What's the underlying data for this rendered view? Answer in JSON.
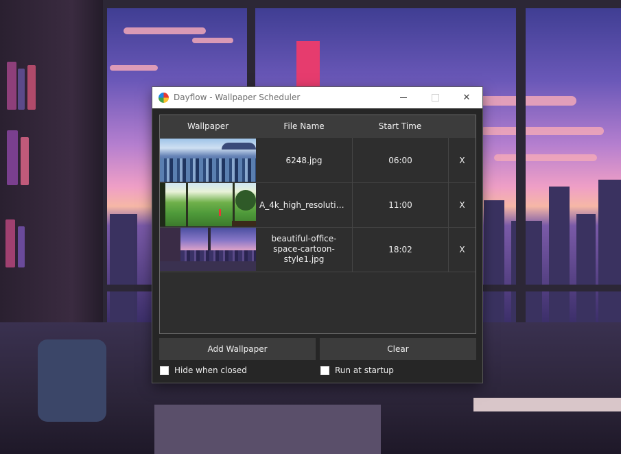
{
  "window": {
    "title": "Dayflow - Wallpaper Scheduler",
    "controls": {
      "minimize": "minimize-icon",
      "maximize": "maximize-icon",
      "close": "✕"
    }
  },
  "table": {
    "headers": [
      "Wallpaper",
      "File Name",
      "Start Time",
      ""
    ],
    "rows": [
      {
        "thumbnail": "city-skyline-thumbnail",
        "file_name": "6248.jpg",
        "start_time": "06:00",
        "remove": "X"
      },
      {
        "thumbnail": "golf-course-thumbnail",
        "file_name": "A_4k_high_resolution_...",
        "start_time": "11:00",
        "remove": "X"
      },
      {
        "thumbnail": "office-window-thumbnail",
        "file_name": "beautiful-office-space-cartoon-style1.jpg",
        "start_time": "18:02",
        "remove": "X"
      }
    ]
  },
  "buttons": {
    "add": "Add Wallpaper",
    "clear": "Clear"
  },
  "options": {
    "hide_when_closed": {
      "label": "Hide when closed",
      "checked": false
    },
    "run_at_startup": {
      "label": "Run at startup",
      "checked": false
    }
  },
  "colors": {
    "window_bg": "#262626",
    "header_bg": "#3c3c3c",
    "button_bg": "#3c3c3c",
    "text": "#f0f0f0"
  }
}
